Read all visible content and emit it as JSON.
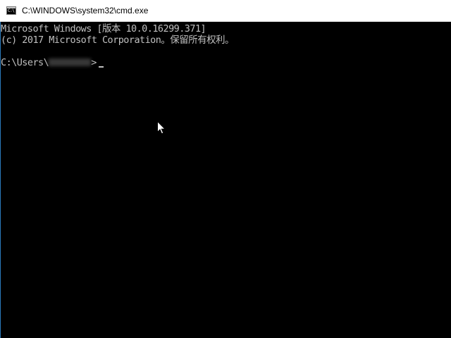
{
  "window": {
    "title": "C:\\WINDOWS\\system32\\cmd.exe",
    "icon": "cmd-app-icon",
    "icon_glyph": "C:\\"
  },
  "console": {
    "background_color": "#000000",
    "text_color": "#c0c0c0",
    "version_line": "Microsoft Windows [版本 10.0.16299.371]",
    "copyright_line": "(c) 2017 Microsoft Corporation。保留所有权利。",
    "prompt_prefix": "C:\\Users\\",
    "prompt_user": "J▮▮▮▮▮▮▮",
    "prompt_suffix": ">"
  },
  "pointer": {
    "icon": "mouse-pointer-icon"
  }
}
